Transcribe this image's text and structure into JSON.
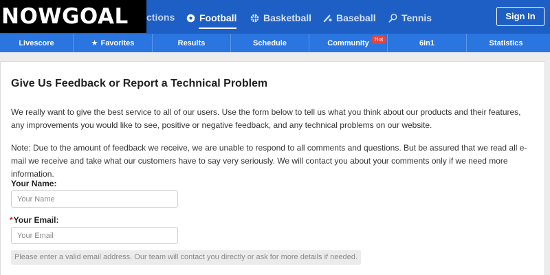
{
  "header": {
    "logo_text": "NOWGOAL",
    "partial_nav_text": "ctions",
    "sports": [
      {
        "label": "Football",
        "icon": "football-icon",
        "active": true
      },
      {
        "label": "Basketball",
        "icon": "basketball-icon",
        "active": false
      },
      {
        "label": "Baseball",
        "icon": "baseball-icon",
        "active": false
      },
      {
        "label": "Tennis",
        "icon": "tennis-icon",
        "active": false
      }
    ],
    "signin_label": "Sign In"
  },
  "navbar": {
    "items": [
      {
        "label": "Livescore"
      },
      {
        "label": "Favorites",
        "icon": "star-icon"
      },
      {
        "label": "Results"
      },
      {
        "label": "Schedule"
      },
      {
        "label": "Community",
        "badge": "Hot"
      },
      {
        "label": "6in1"
      },
      {
        "label": "Statistics"
      }
    ]
  },
  "main": {
    "title": "Give Us Feedback or Report a Technical Problem",
    "paragraph1": "We really want to give the best service to all of our users. Use the form below to tell us what you think about our products and their features, any improvements you would like to see, positive or negative feedback, and any technical problems on our website.",
    "paragraph2": "Note: Due to the amount of feedback we receive, we are unable to respond to all comments and questions. But be assured that we read all e-mail we receive and take what our customers have to say very seriously. We will contact you about your comments only if we need more information.",
    "form": {
      "name_label": "Your Name:",
      "name_placeholder": "Your Name",
      "email_required_mark": "*",
      "email_label": "Your Email:",
      "email_placeholder": "Your Email",
      "email_hint": "Please enter a valid email address. Our team will contact you directly or ask for more details if needed."
    }
  },
  "colors": {
    "header_bg": "#1d5fc4",
    "navbar_bg": "#2a75e0",
    "hot_badge": "#e8423d",
    "required_mark": "#d02020"
  }
}
